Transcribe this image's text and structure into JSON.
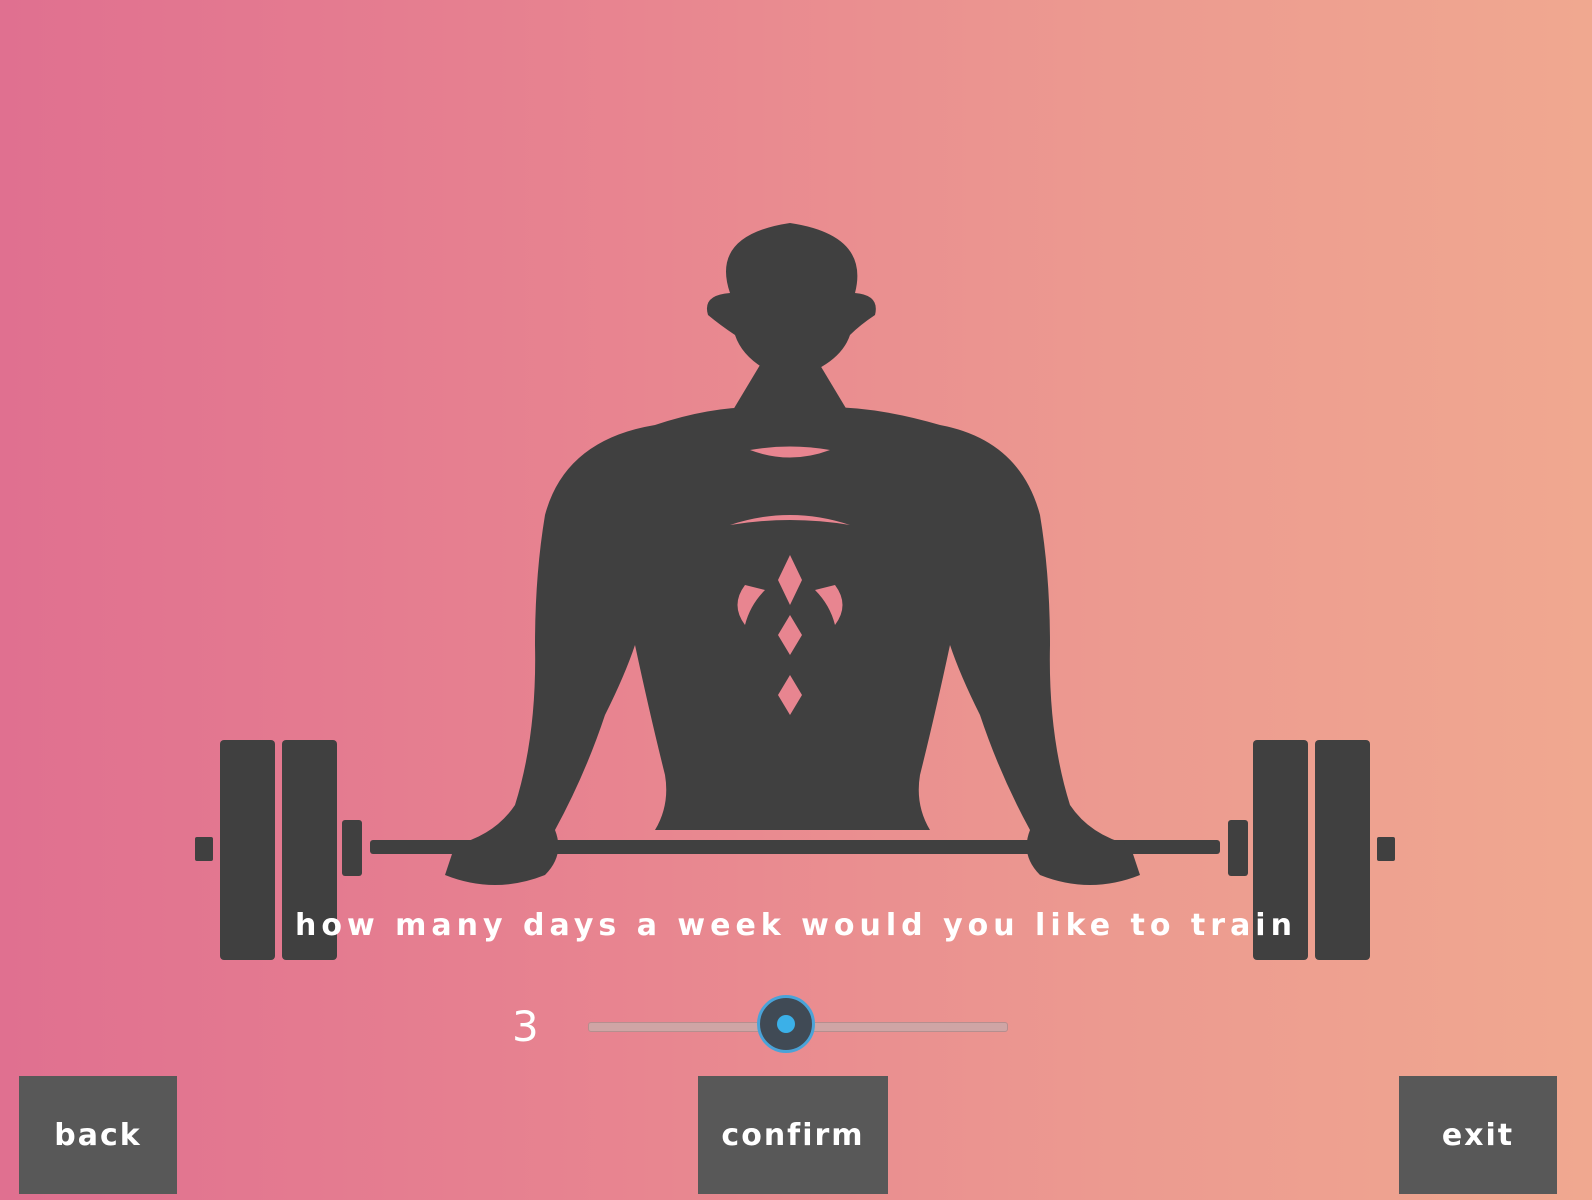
{
  "question": "How many days a week would you like to Train",
  "slider": {
    "value": "3",
    "min": 1,
    "max": 7,
    "current": 3,
    "thumb_color": "#3bb0e8"
  },
  "buttons": {
    "back": "Back",
    "confirm": "Confirm",
    "exit": "Exit"
  },
  "hero": {
    "icon": "weightlifter-icon",
    "silhouette_color": "#404040"
  },
  "colors": {
    "gradient_start": "#e07090",
    "gradient_end": "#f0a890",
    "button_bg": "#585858"
  }
}
